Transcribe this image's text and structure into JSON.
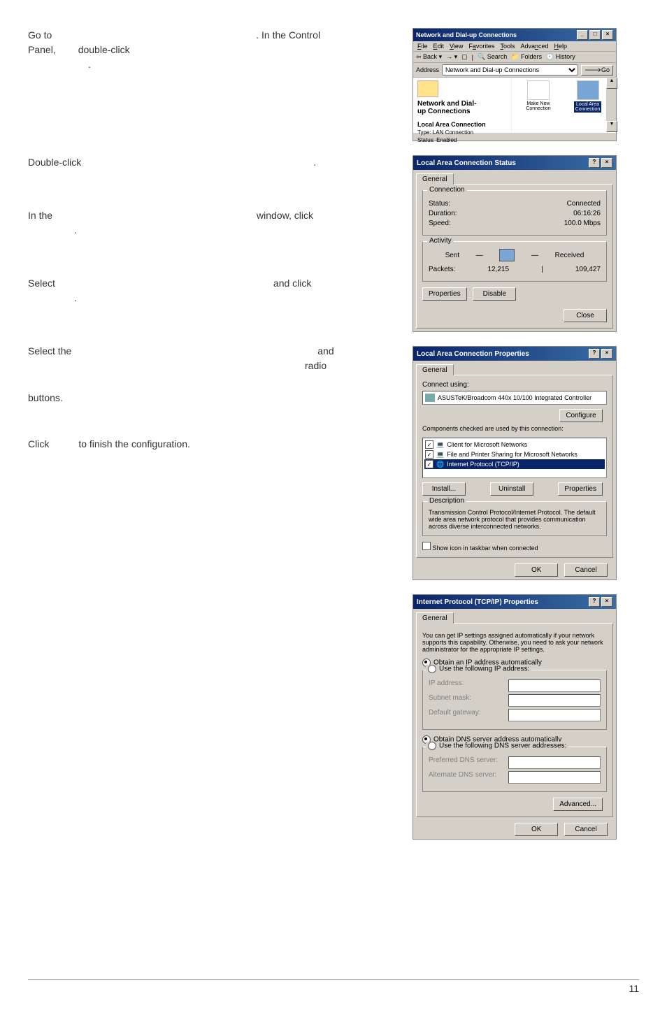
{
  "instructions": {
    "i1a": "Go to",
    "i1b": ". In the Control",
    "i1c": "Panel,",
    "i1d": "double-click",
    "i1e": ".",
    "i2a": "Double-click",
    "i2b": ".",
    "i3a": "In  the",
    "i3b": "window,  click",
    "i3c": ".",
    "i4a": "Select",
    "i4b": "and    click",
    "i4c": ".",
    "i5a": "Select  the",
    "i5b": "and",
    "i5c": "radio",
    "i6": "buttons.",
    "i7a": "Click",
    "i7b": "to finish the configuration."
  },
  "win1": {
    "title": "Network and Dial-up Connections",
    "menu": [
      "File",
      "Edit",
      "View",
      "Favorites",
      "Tools",
      "Advanced",
      "Help"
    ],
    "back": "Back",
    "search": "Search",
    "folders": "Folders",
    "history": "History",
    "addrlabel": "Address",
    "addrval": "Network and Dial-up Connections",
    "go": "Go",
    "panelTitle1": "Network and Dial-",
    "panelTitle2": "up Connections",
    "sub": "Local Area Connection",
    "type": "Type: LAN Connection",
    "status": "Status: Enabled",
    "icon1": "Make New Connection",
    "icon2a": "Local Area",
    "icon2b": "Connection"
  },
  "status": {
    "title": "Local Area Connection Status",
    "tab": "General",
    "grp1": "Connection",
    "statusL": "Status:",
    "statusV": "Connected",
    "durL": "Duration:",
    "durV": "06:16:26",
    "spdL": "Speed:",
    "spdV": "100.0 Mbps",
    "grp2": "Activity",
    "sent": "Sent",
    "recv": "Received",
    "pktL": "Packets:",
    "pktS": "12,215",
    "pktR": "109,427",
    "btnProp": "Properties",
    "btnDis": "Disable",
    "btnClose": "Close"
  },
  "props": {
    "title": "Local Area Connection Properties",
    "tab": "General",
    "connUsing": "Connect using:",
    "adapter": "ASUSTeK/Broadcom 440x 10/100 Integrated Controller",
    "btnCfg": "Configure",
    "compLbl": "Components checked are used by this connection:",
    "c1": "Client for Microsoft Networks",
    "c2": "File and Printer Sharing for Microsoft Networks",
    "c3": "Internet Protocol (TCP/IP)",
    "btnInst": "Install...",
    "btnUninst": "Uninstall",
    "btnProp": "Properties",
    "descLegend": "Description",
    "desc": "Transmission Control Protocol/Internet Protocol. The default wide area network protocol that provides communication across diverse interconnected networks.",
    "showIcon": "Show icon in taskbar when connected",
    "ok": "OK",
    "cancel": "Cancel"
  },
  "tcp": {
    "title": "Internet Protocol (TCP/IP) Properties",
    "tab": "General",
    "blurb": "You can get IP settings assigned automatically if your network supports this capability. Otherwise, you need to ask your network administrator for the appropriate IP settings.",
    "r1": "Obtain an IP address automatically",
    "r2": "Use the following IP address:",
    "ip": "IP address:",
    "mask": "Subnet mask:",
    "gw": "Default gateway:",
    "r3": "Obtain DNS server address automatically",
    "r4": "Use the following DNS server addresses:",
    "pdns": "Preferred DNS server:",
    "adns": "Alternate DNS server:",
    "adv": "Advanced...",
    "ok": "OK",
    "cancel": "Cancel"
  },
  "pageNum": "11"
}
